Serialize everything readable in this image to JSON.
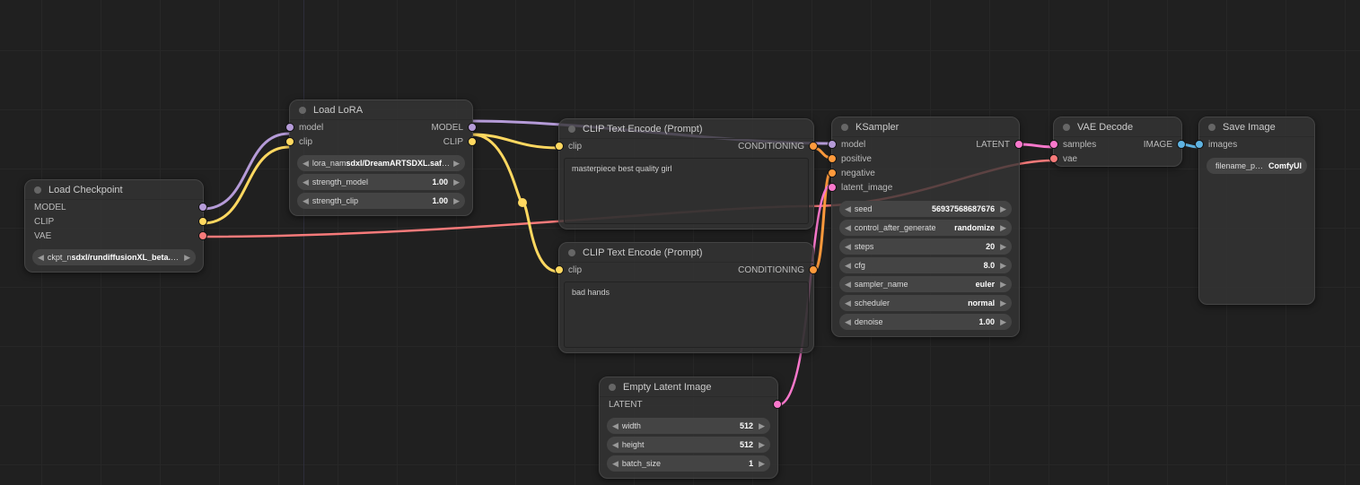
{
  "nodes": {
    "load_checkpoint": {
      "title": "Load Checkpoint",
      "outputs": {
        "model": "MODEL",
        "clip": "CLIP",
        "vae": "VAE"
      },
      "widgets": {
        "ckpt": {
          "label": "ckpt_n",
          "value": "sdxl/rundiffusionXL_beta.safetensors"
        }
      }
    },
    "load_lora": {
      "title": "Load LoRA",
      "inputs": {
        "model": "model",
        "clip": "clip"
      },
      "outputs": {
        "model": "MODEL",
        "clip": "CLIP"
      },
      "widgets": {
        "lora": {
          "label": "lora_nam",
          "value": "sdxl/DreamARTSDXL.safetensors"
        },
        "sm": {
          "label": "strength_model",
          "value": "1.00"
        },
        "sc": {
          "label": "strength_clip",
          "value": "1.00"
        }
      }
    },
    "clip_pos": {
      "title": "CLIP Text Encode (Prompt)",
      "inputs": {
        "clip": "clip"
      },
      "outputs": {
        "cond": "CONDITIONING"
      },
      "text": "masterpiece best quality girl"
    },
    "clip_neg": {
      "title": "CLIP Text Encode (Prompt)",
      "inputs": {
        "clip": "clip"
      },
      "outputs": {
        "cond": "CONDITIONING"
      },
      "text": "bad hands"
    },
    "empty_latent": {
      "title": "Empty Latent Image",
      "outputs": {
        "latent": "LATENT"
      },
      "widgets": {
        "w": {
          "label": "width",
          "value": "512"
        },
        "h": {
          "label": "height",
          "value": "512"
        },
        "b": {
          "label": "batch_size",
          "value": "1"
        }
      }
    },
    "ksampler": {
      "title": "KSampler",
      "inputs": {
        "model": "model",
        "positive": "positive",
        "negative": "negative",
        "latent": "latent_image"
      },
      "outputs": {
        "latent": "LATENT"
      },
      "widgets": {
        "seed": {
          "label": "seed",
          "value": "56937568687676"
        },
        "cag": {
          "label": "control_after_generate",
          "value": "randomize"
        },
        "steps": {
          "label": "steps",
          "value": "20"
        },
        "cfg": {
          "label": "cfg",
          "value": "8.0"
        },
        "sampler": {
          "label": "sampler_name",
          "value": "euler"
        },
        "sched": {
          "label": "scheduler",
          "value": "normal"
        },
        "denoise": {
          "label": "denoise",
          "value": "1.00"
        }
      }
    },
    "vae_decode": {
      "title": "VAE Decode",
      "inputs": {
        "samples": "samples",
        "vae": "vae"
      },
      "outputs": {
        "image": "IMAGE"
      }
    },
    "save_image": {
      "title": "Save Image",
      "inputs": {
        "images": "images"
      },
      "widgets": {
        "fp": {
          "label": "filename_prefix",
          "value": "ComfyUI"
        }
      }
    }
  }
}
